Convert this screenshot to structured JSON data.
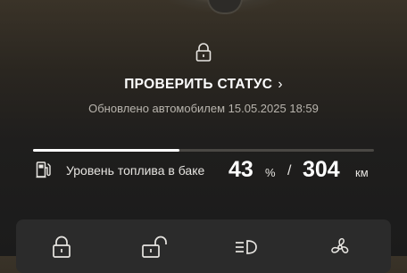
{
  "status": {
    "link_label": "ПРОВЕРИТЬ СТАТУС",
    "chevron_glyph": "›",
    "updated_text": "Обновлено автомобилем 15.05.2025 18:59",
    "lock_icon": "padlock-closed-icon"
  },
  "fuel": {
    "label": "Уровень топлива в баке",
    "percent": "43",
    "percent_unit": "%",
    "separator": "/",
    "range": "304",
    "range_unit": "км",
    "level_fraction": 0.43,
    "icon": "fuel-pump-icon"
  },
  "quick_actions": [
    {
      "icon": "lock-icon"
    },
    {
      "icon": "unlock-icon"
    },
    {
      "icon": "headlights-icon"
    },
    {
      "icon": "fan-icon"
    }
  ],
  "colors": {
    "text_primary": "#ffffff",
    "text_secondary": "#b8b4ad",
    "panel_bg": "#2b2b2b",
    "bar_track": "#4a4844",
    "bar_fill": "#ffffff"
  }
}
